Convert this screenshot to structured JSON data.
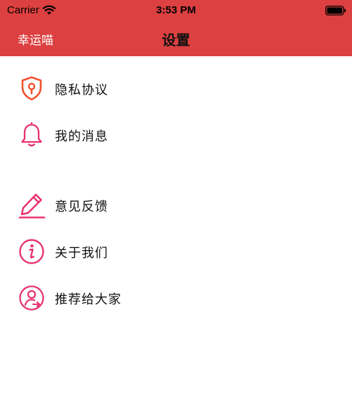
{
  "status_bar": {
    "carrier": "Carrier",
    "time": "3:53 PM",
    "wifi_icon": "wifi-icon",
    "battery_icon": "battery-icon"
  },
  "nav": {
    "left_label": "幸运喵",
    "title": "设置"
  },
  "colors": {
    "header_bg": "#dd4040",
    "icon_orange": "#f0522f",
    "icon_pink": "#e8336d"
  },
  "menu": {
    "items": [
      {
        "label": "隐私协议",
        "icon": "shield-lock-icon"
      },
      {
        "label": "我的消息",
        "icon": "bell-icon"
      },
      {
        "label": "意见反馈",
        "icon": "pen-edit-icon"
      },
      {
        "label": "关于我们",
        "icon": "info-icon"
      },
      {
        "label": "推荐给大家",
        "icon": "user-share-icon"
      }
    ]
  }
}
